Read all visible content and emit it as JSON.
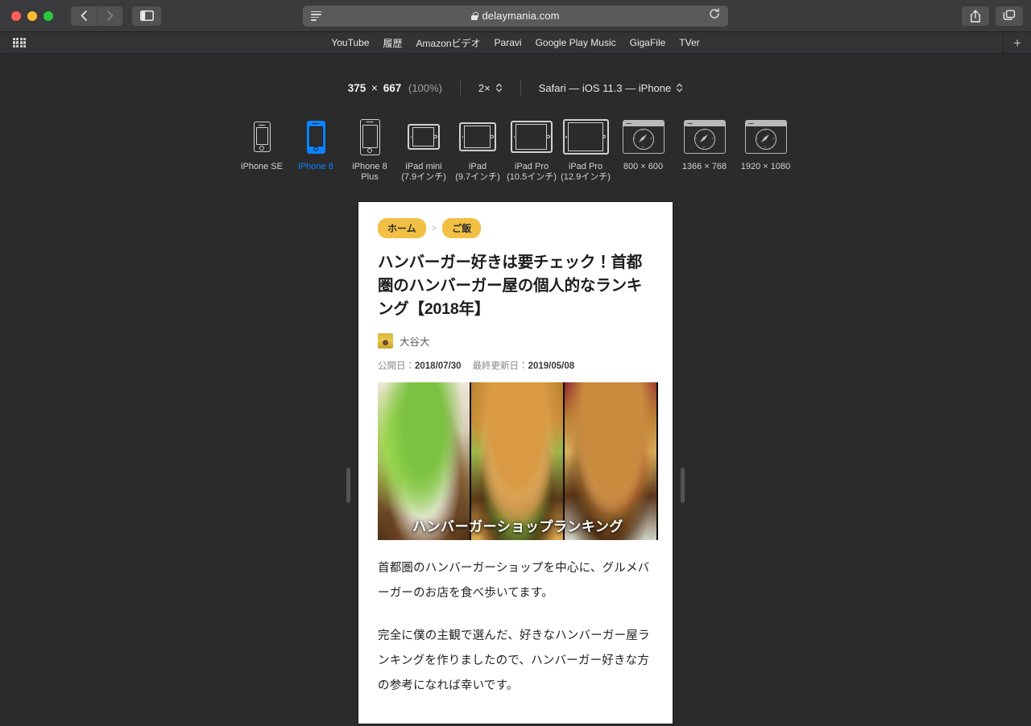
{
  "browser": {
    "window_controls": [
      "close",
      "minimize",
      "zoom"
    ],
    "back_label": "back",
    "forward_label": "forward",
    "sidebar_label": "sidebar",
    "url": "delaymania.com",
    "reader_icon": "reader-icon",
    "lock_icon": "lock-icon",
    "reload_icon": "reload-icon",
    "share_icon": "share-icon",
    "tabs_icon": "tab-overview-icon",
    "new_tab_label": "+"
  },
  "bookmarks": {
    "grid_icon": "grid-icon",
    "items": [
      {
        "label": "YouTube"
      },
      {
        "label": "履歴"
      },
      {
        "label": "Amazonビデオ"
      },
      {
        "label": "Paravi"
      },
      {
        "label": "Google Play Music"
      },
      {
        "label": "GigaFile"
      },
      {
        "label": "TVer"
      }
    ]
  },
  "rdm": {
    "size_width": "375",
    "size_sep": "×",
    "size_height": "667",
    "size_percent": "(100%)",
    "pixel_ratio": "2×",
    "user_agent": "Safari — iOS 11.3 — iPhone",
    "devices": [
      {
        "name": "iPhone SE",
        "label": "iPhone SE",
        "type": "phone",
        "selected": false
      },
      {
        "name": "iPhone 8",
        "label": "iPhone 8",
        "type": "phone",
        "selected": true
      },
      {
        "name": "iPhone 8 Plus",
        "label": "iPhone 8\nPlus",
        "type": "phone",
        "selected": false
      },
      {
        "name": "iPad mini",
        "label": "iPad mini\n(7.9インチ)",
        "type": "tablet",
        "selected": false
      },
      {
        "name": "iPad",
        "label": "iPad\n(9.7インチ)",
        "type": "tablet",
        "selected": false
      },
      {
        "name": "iPad Pro 10.5",
        "label": "iPad Pro\n(10.5インチ)",
        "type": "tablet",
        "selected": false
      },
      {
        "name": "iPad Pro 12.9",
        "label": "iPad Pro\n(12.9インチ)",
        "type": "tablet",
        "selected": false
      },
      {
        "name": "800x600",
        "label": "800 × 600",
        "type": "desktop",
        "selected": false
      },
      {
        "name": "1366x768",
        "label": "1366 × 768",
        "type": "desktop",
        "selected": false
      },
      {
        "name": "1920x1080",
        "label": "1920 × 1080",
        "type": "desktop",
        "selected": false
      }
    ]
  },
  "page": {
    "breadcrumbs": [
      {
        "label": "ホーム"
      },
      {
        "label": "ご飯"
      }
    ],
    "breadcrumb_separator": ">",
    "title": "ハンバーガー好きは要チェック！首都圏のハンバーガー屋の個人的なランキング【2018年】",
    "author": "大谷大",
    "published_label": "公開日：",
    "published_date": "2018/07/30",
    "updated_label": "最終更新日：",
    "updated_date": "2019/05/08",
    "hero_caption": "ハンバーガーショップランキング",
    "paragraphs": [
      "首都圏のハンバーガーショップを中心に、グルメバーガーのお店を食べ歩いてます。",
      "完全に僕の主観で選んだ、好きなハンバーガー屋ランキングを作りましたので、ハンバーガー好きな方の参考になれば幸いです。"
    ]
  },
  "colors": {
    "accent_blue": "#0a84ff",
    "breadcrumb_yellow": "#f2c044",
    "chrome_dark": "#3b3b3d",
    "canvas_dark": "#2b2b2b"
  }
}
